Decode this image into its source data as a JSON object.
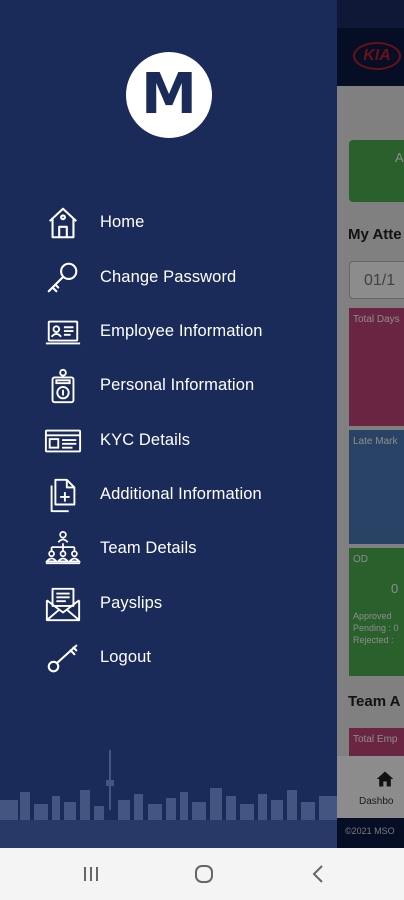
{
  "drawer": {
    "avatar_letter": "M",
    "menu_items": [
      {
        "label": "Home",
        "icon": "home-icon"
      },
      {
        "label": "Change Password",
        "icon": "key-icon"
      },
      {
        "label": "Employee Information",
        "icon": "id-card-icon"
      },
      {
        "label": "Personal Information",
        "icon": "badge-icon"
      },
      {
        "label": "KYC Details",
        "icon": "document-card-icon"
      },
      {
        "label": "Additional Information",
        "icon": "add-document-icon"
      },
      {
        "label": "Team Details",
        "icon": "team-hierarchy-icon"
      },
      {
        "label": "Payslips",
        "icon": "envelope-icon"
      },
      {
        "label": "Logout",
        "icon": "logout-key-icon"
      }
    ]
  },
  "background_app": {
    "logo_text": "KIA",
    "green_button_text": "A",
    "section_attendance": "My Atte",
    "date_value": "01/1",
    "card_total_days": "Total Days",
    "card_late_mark": "Late Mark",
    "card_od": "OD",
    "card_od_value": "0",
    "card_od_sub": [
      "Approved",
      "Pending : 0",
      "Rejected :"
    ],
    "section_team": "Team A",
    "card_total_emp": "Total Emp",
    "nav_dashboard": "Dashbo",
    "footer": "©2021 MSO"
  },
  "colors": {
    "drawer_bg": "#1a2b5a",
    "header_bg": "#0b1b46",
    "green": "#4caf50",
    "pink": "#c2447a",
    "blue": "#4a7ab8",
    "brand_red": "#c0202a"
  }
}
